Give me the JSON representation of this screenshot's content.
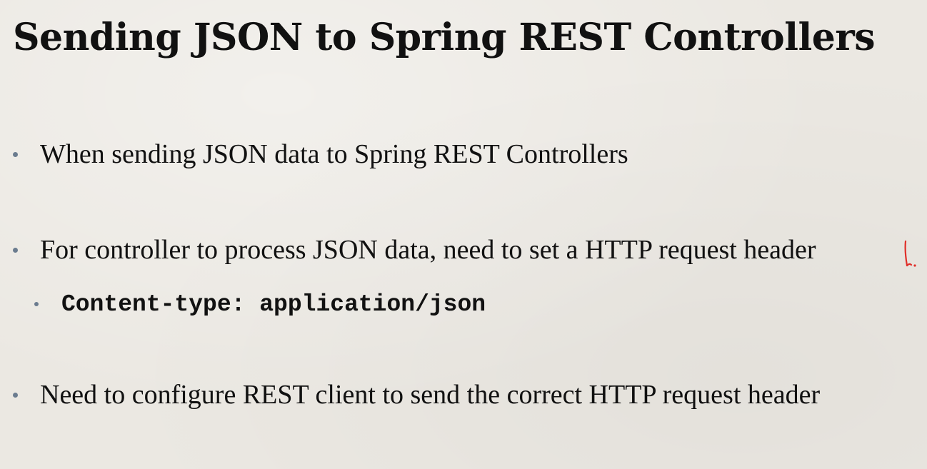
{
  "slide": {
    "title": "Sending JSON to Spring REST Controllers",
    "bullets": [
      {
        "text": "When sending JSON data to Spring REST Controllers"
      },
      {
        "text": "For controller to process JSON data, need to set a HTTP request header"
      },
      {
        "text": "Need to configure REST client to send the correct HTTP request header"
      }
    ],
    "sub_bullet": {
      "text": "Content-type: application/json"
    },
    "annotation": {
      "color": "#e0302a",
      "icon": "handwritten-mark"
    }
  }
}
